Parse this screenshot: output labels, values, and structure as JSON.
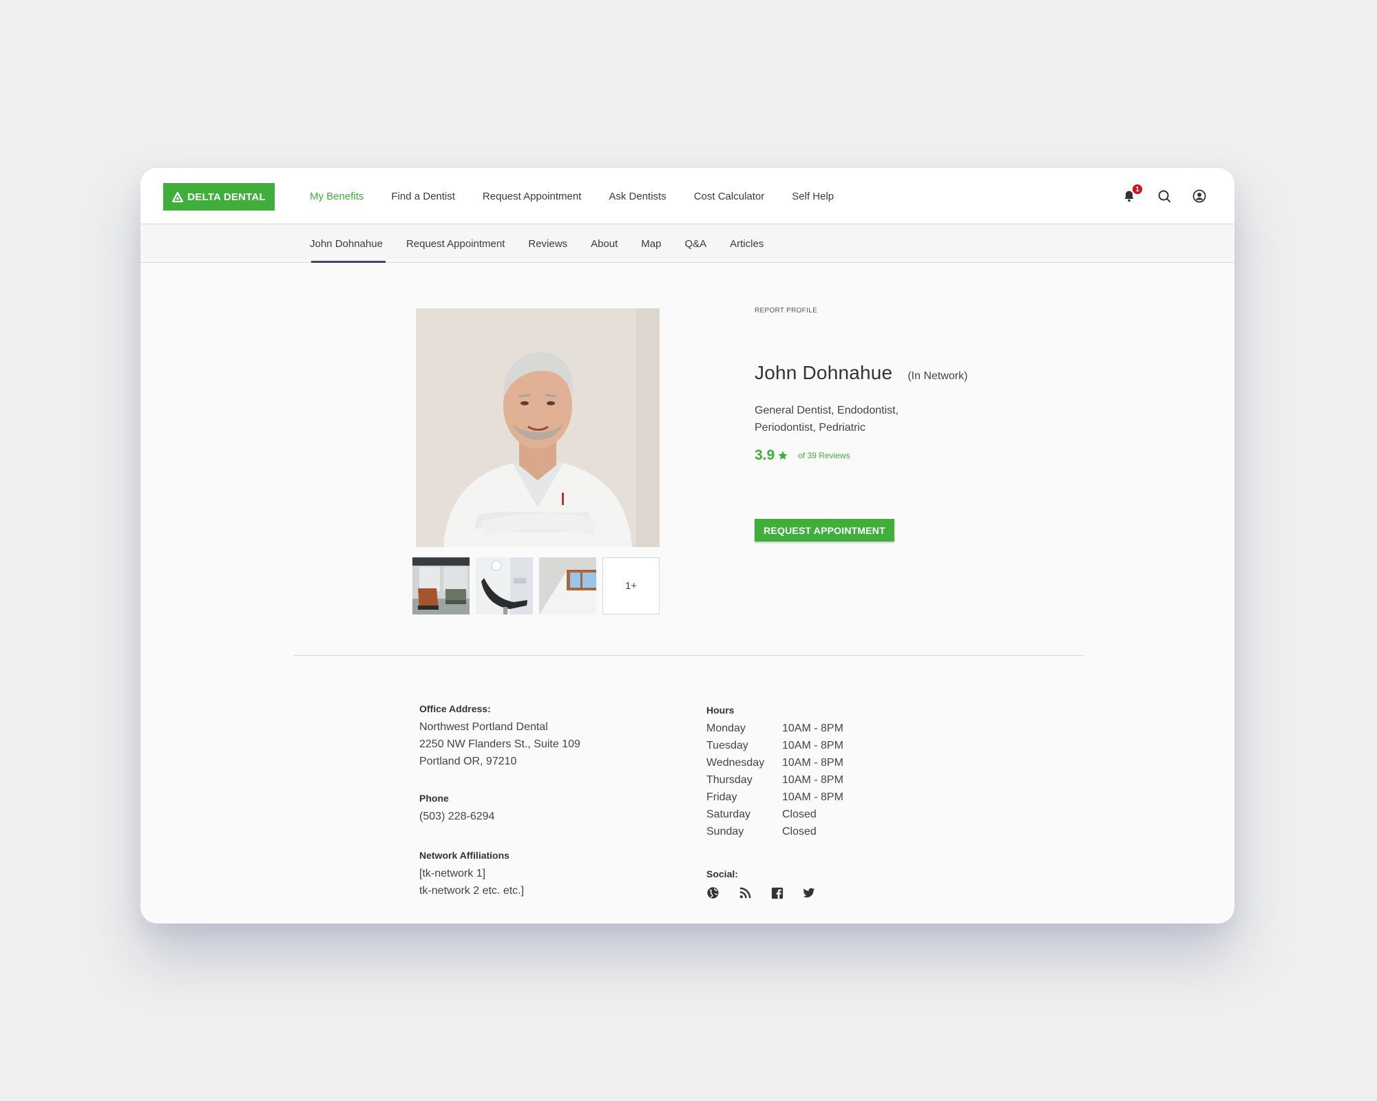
{
  "brand": {
    "logo_text": "DELTA DENTAL",
    "color": "#3fae3b"
  },
  "main_nav": {
    "items": [
      {
        "label": "My Benefits",
        "active": true
      },
      {
        "label": "Find a Dentist"
      },
      {
        "label": "Request Appointment"
      },
      {
        "label": "Ask Dentists"
      },
      {
        "label": "Cost Calculator"
      },
      {
        "label": "Self Help"
      }
    ],
    "notifications_count": "1",
    "icons": [
      "bell-icon",
      "search-icon",
      "account-icon"
    ]
  },
  "sub_nav": {
    "items": [
      {
        "label": "John Dohnahue",
        "active": true
      },
      {
        "label": "Request Appointment"
      },
      {
        "label": "Reviews"
      },
      {
        "label": "About"
      },
      {
        "label": "Map"
      },
      {
        "label": "Q&A"
      },
      {
        "label": "Articles"
      }
    ]
  },
  "profile": {
    "report_label": "REPORT PROFILE",
    "name": "John Dohnahue",
    "network_status": "(In Network)",
    "specialties_line1": "General Dentist, Endodontist,",
    "specialties_line2": "Periodontist, Pedriatric",
    "rating": "3.9",
    "reviews_text": "of 39 Reviews",
    "request_button": "REQUEST APPOINTMENT",
    "more_photos_label": "1+"
  },
  "office": {
    "address_label": "Office Address:",
    "address_line1": "Northwest Portland Dental",
    "address_line2": "2250 NW Flanders St., Suite 109",
    "address_line3": "Portland OR, 97210",
    "phone_label": "Phone",
    "phone": "(503) 228-6294",
    "networks_label": "Network Affiliations",
    "network_line1": "[tk-network 1]",
    "network_line2": "tk-network 2 etc. etc.]"
  },
  "hours": {
    "label": "Hours",
    "rows": [
      {
        "day": "Monday",
        "time": "10AM - 8PM"
      },
      {
        "day": "Tuesday",
        "time": "10AM - 8PM"
      },
      {
        "day": "Wednesday",
        "time": "10AM - 8PM"
      },
      {
        "day": "Thursday",
        "time": "10AM - 8PM"
      },
      {
        "day": "Friday",
        "time": "10AM - 8PM"
      },
      {
        "day": "Saturday",
        "time": "Closed"
      },
      {
        "day": "Sunday",
        "time": "Closed"
      }
    ]
  },
  "social": {
    "label": "Social:",
    "icons": [
      "globe-icon",
      "rss-icon",
      "facebook-icon",
      "twitter-icon"
    ]
  }
}
